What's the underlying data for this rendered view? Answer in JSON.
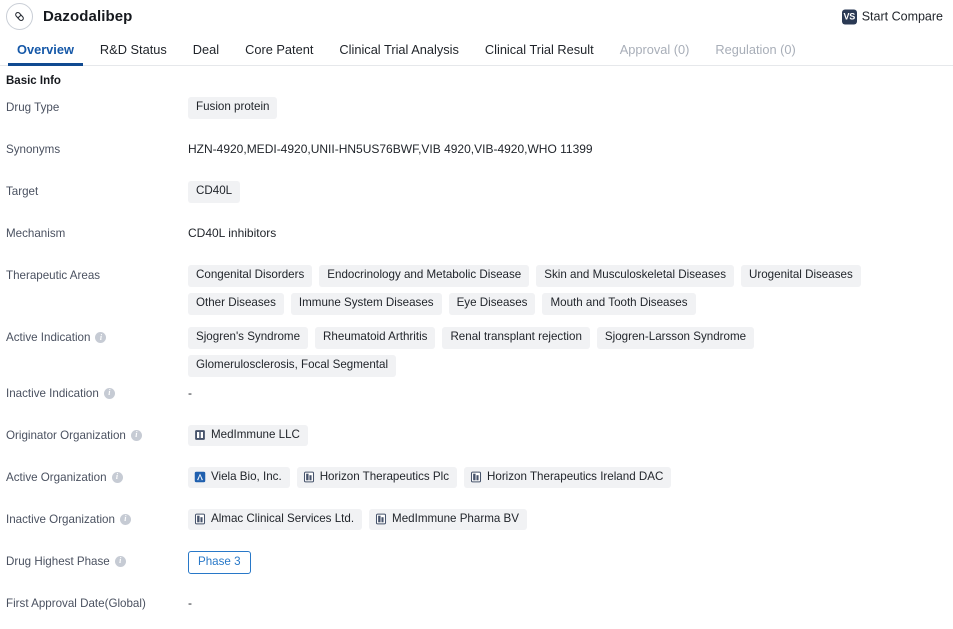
{
  "header": {
    "drug_name": "Dazodalibep",
    "drug_icon": "pill-capsule-icon",
    "compare_label": "Start Compare",
    "compare_badge": "VS"
  },
  "tabs": [
    {
      "label": "Overview",
      "state": "active"
    },
    {
      "label": "R&D Status",
      "state": "normal"
    },
    {
      "label": "Deal",
      "state": "normal"
    },
    {
      "label": "Core Patent",
      "state": "normal"
    },
    {
      "label": "Clinical Trial Analysis",
      "state": "normal"
    },
    {
      "label": "Clinical Trial Result",
      "state": "normal"
    },
    {
      "label": "Approval (0)",
      "state": "disabled"
    },
    {
      "label": "Regulation (0)",
      "state": "disabled"
    }
  ],
  "section": {
    "title": "Basic Info"
  },
  "rows": {
    "drug_type": {
      "label": "Drug Type",
      "tags": [
        "Fusion protein"
      ]
    },
    "synonyms": {
      "label": "Synonyms",
      "text": "HZN-4920,MEDI-4920,UNII-HN5US76BWF,VIB 4920,VIB-4920,WHO 11399"
    },
    "target": {
      "label": "Target",
      "tags": [
        "CD40L"
      ]
    },
    "mechanism": {
      "label": "Mechanism",
      "text": "CD40L inhibitors"
    },
    "therapeutic_areas": {
      "label": "Therapeutic Areas",
      "tags": [
        "Congenital Disorders",
        "Endocrinology and Metabolic Disease",
        "Skin and Musculoskeletal Diseases",
        "Urogenital Diseases",
        "Other Diseases",
        "Immune System Diseases",
        "Eye Diseases",
        "Mouth and Tooth Diseases"
      ]
    },
    "active_indication": {
      "label": "Active Indication",
      "has_info": true,
      "tags": [
        "Sjogren's Syndrome",
        "Rheumatoid Arthritis",
        "Renal transplant rejection",
        "Sjogren-Larsson Syndrome",
        "Glomerulosclerosis, Focal Segmental"
      ]
    },
    "inactive_indication": {
      "label": "Inactive Indication",
      "has_info": true,
      "text": "-"
    },
    "originator_organization": {
      "label": "Originator Organization",
      "has_info": true,
      "orgs": [
        {
          "name": "MedImmune LLC",
          "icon": "building-icon"
        }
      ]
    },
    "active_organization": {
      "label": "Active Organization",
      "has_info": true,
      "orgs": [
        {
          "name": "Viela Bio, Inc.",
          "icon": "company-logo-icon"
        },
        {
          "name": "Horizon Therapeutics Plc",
          "icon": "building-icon"
        },
        {
          "name": "Horizon Therapeutics Ireland DAC",
          "icon": "building-icon"
        }
      ]
    },
    "inactive_organization": {
      "label": "Inactive Organization",
      "has_info": true,
      "orgs": [
        {
          "name": "Almac Clinical Services Ltd.",
          "icon": "building-icon"
        },
        {
          "name": "MedImmune Pharma BV",
          "icon": "building-icon"
        }
      ]
    },
    "drug_highest_phase": {
      "label": "Drug Highest Phase",
      "has_info": true,
      "badge": "Phase 3"
    },
    "first_approval_date": {
      "label": "First Approval Date(Global)",
      "text": "-"
    }
  },
  "colors": {
    "accent_blue": "#1558a8",
    "tab_underline": "#104a91",
    "tag_bg": "#f1f2f4",
    "phase_blue": "#2878c8",
    "label_gray": "#4a5160",
    "disabled_gray": "#a8aeb8"
  }
}
